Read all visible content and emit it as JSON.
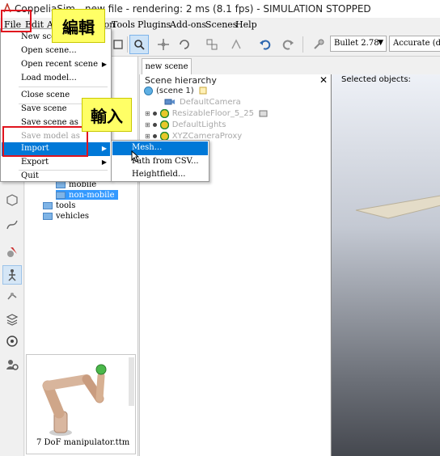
{
  "window": {
    "title": "CoppeliaSim - new file - rendering: 2 ms (8.1 fps) - SIMULATION STOPPED"
  },
  "menubar": [
    "File",
    "Edit",
    "Add",
    "Simulation",
    "Tools",
    "Plugins",
    "Add-ons",
    "Scenes",
    "Help"
  ],
  "toolbar": {
    "engine": "Bullet 2.78",
    "accuracy": "Accurate (default)"
  },
  "model_browser": {
    "folders": [
      "mobile",
      "non-mobile",
      "tools",
      "vehicles"
    ],
    "selected_folder": "non-mobile",
    "thumbnail_label": "7 DoF manipulator.ttm"
  },
  "scene_tab": "new scene",
  "hierarchy": {
    "title": "Scene hierarchy",
    "root": "(scene 1)",
    "items": [
      "DefaultCamera",
      "ResizableFloor_5_25",
      "DefaultLights",
      "XYZCameraProxy"
    ]
  },
  "viewport": {
    "selected_label": "Selected objects:"
  },
  "file_menu": {
    "items": [
      "New scene",
      "Open scene...",
      "Open recent scene",
      "Load model...",
      "Close scene",
      "Save scene",
      "Save scene as",
      "Save model as",
      "Import",
      "Export",
      "Quit"
    ]
  },
  "import_submenu": {
    "items": [
      "Mesh...",
      "Path from CSV...",
      "Heightfield..."
    ]
  },
  "annotations": {
    "edit_callout": "編輯",
    "import_callout": "輸入",
    "highlight_color": "#e0141e",
    "callout_color": "#ffff66"
  }
}
